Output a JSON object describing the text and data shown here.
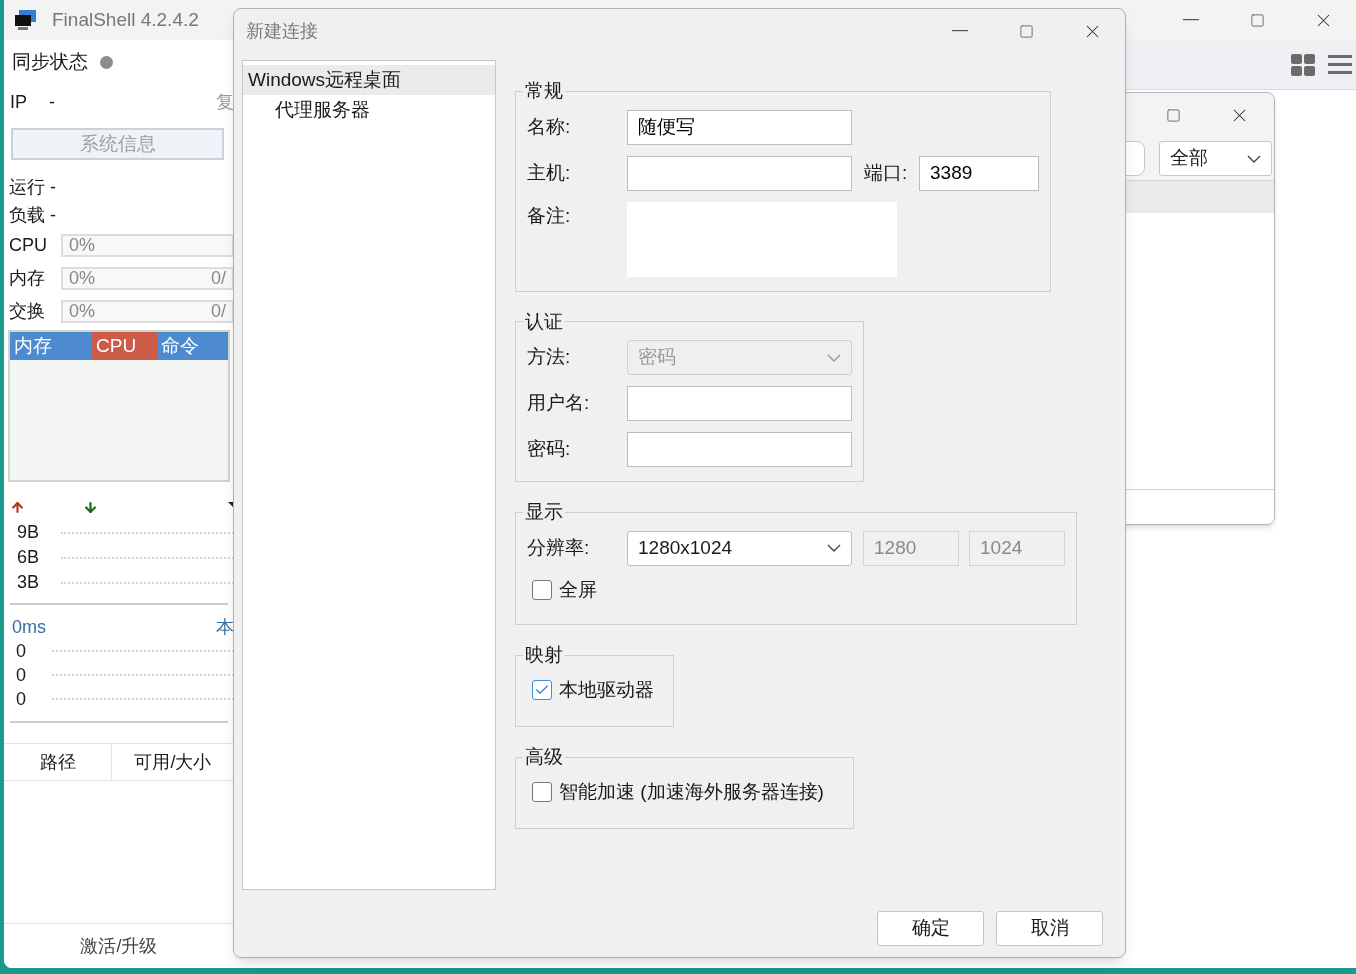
{
  "main_window": {
    "title": "FinalShell 4.2.4.2"
  },
  "side_panel": {
    "sync_label": "同步状态",
    "ip_label": "IP",
    "ip_value": "-",
    "copy_link": "复",
    "sysinfo_button": "系统信息",
    "uptime": "运行 -",
    "load": "负载 -",
    "meters": [
      {
        "label": "CPU",
        "reading": "0%",
        "level": 0
      },
      {
        "label": "内存",
        "reading": "0%",
        "total": "0/",
        "level": 0
      },
      {
        "label": "交换",
        "reading": "0%",
        "total": "0/",
        "level": 0
      }
    ],
    "process_tabs": [
      {
        "label": "内存",
        "selected": false
      },
      {
        "label": "CPU",
        "selected": true
      },
      {
        "label": "命令",
        "selected": false
      }
    ],
    "network": {
      "y_labels": [
        "9B",
        "6B",
        "3B"
      ]
    },
    "latency": {
      "value": "0ms",
      "host": "本",
      "rows": [
        "0",
        "0",
        "0"
      ]
    },
    "disk_table": {
      "columns": [
        "路径",
        "可用/大小"
      ]
    },
    "activate_link": "激活/升级"
  },
  "sub_window": {
    "filter": "全部"
  },
  "dialog": {
    "title": "新建连接",
    "tree": [
      {
        "label": "Windows远程桌面",
        "selected": true,
        "children": [
          {
            "label": "代理服务器",
            "selected": false
          }
        ]
      }
    ],
    "general": {
      "title": "常规",
      "name": {
        "label": "名称:",
        "value": "随便写"
      },
      "host": {
        "label": "主机:"
      },
      "port": {
        "label": "端口:",
        "value": "3389"
      },
      "note": {
        "label": "备注:"
      }
    },
    "auth": {
      "title": "认证",
      "method": {
        "label": "方法:",
        "value": "密码",
        "disabled": true
      },
      "username": {
        "label": "用户名:"
      },
      "password": {
        "label": "密码:"
      }
    },
    "display": {
      "title": "显示",
      "resolution": {
        "label": "分辨率:",
        "value": "1280x1024"
      },
      "width": {
        "value": "1280",
        "disabled": true
      },
      "height": {
        "value": "1024",
        "disabled": true
      },
      "fullscreen": {
        "label": "全屏",
        "checked": false
      }
    },
    "mapping": {
      "title": "映射",
      "options": [
        {
          "label": "本地驱动器",
          "checked": true
        }
      ]
    },
    "advanced": {
      "title": "高级",
      "options": [
        {
          "label": "智能加速 (加速海外服务器连接)",
          "checked": false
        }
      ]
    },
    "buttons": [
      "确定",
      "取消"
    ]
  }
}
